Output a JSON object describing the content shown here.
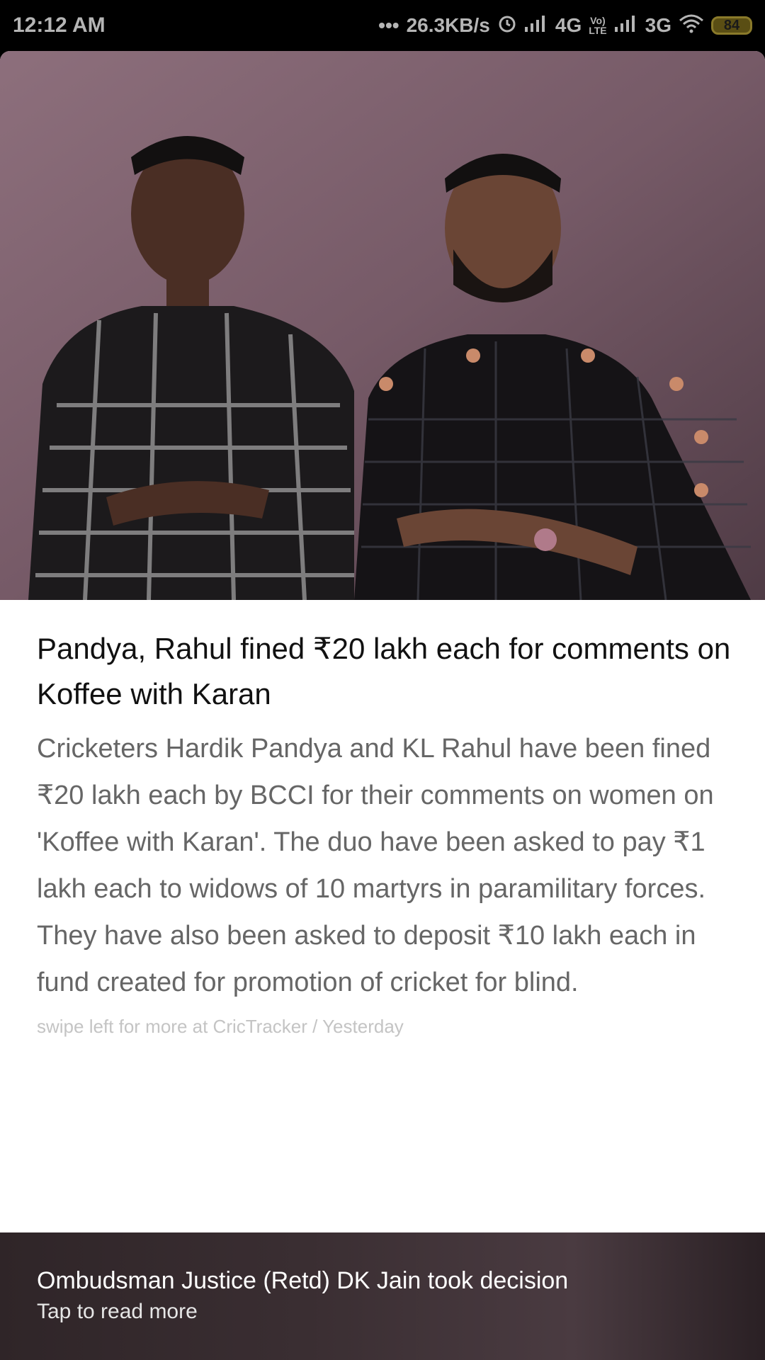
{
  "status_bar": {
    "time": "12:12 AM",
    "dots": "•••",
    "speed": "26.3KB/s",
    "net1": "4G",
    "volte_top": "Vo)",
    "volte_bottom": "LTE",
    "net2": "3G",
    "battery": "84"
  },
  "article": {
    "headline": "Pandya, Rahul fined ₹20 lakh each for comments on Koffee with Karan",
    "body": "Cricketers Hardik Pandya and KL Rahul have been fined ₹20 lakh each by BCCI for their comments on women on 'Koffee with Karan'. The duo have been asked to pay ₹1 lakh each to widows of 10 martyrs in paramilitary forces. They have also been asked to deposit ₹10 lakh each in fund created for promotion of cricket for blind.",
    "source_line": "swipe left for more at CricTracker / Yesterday"
  },
  "footer": {
    "title": "Ombudsman Justice (Retd) DK Jain took decision",
    "subtitle": "Tap to read more"
  }
}
